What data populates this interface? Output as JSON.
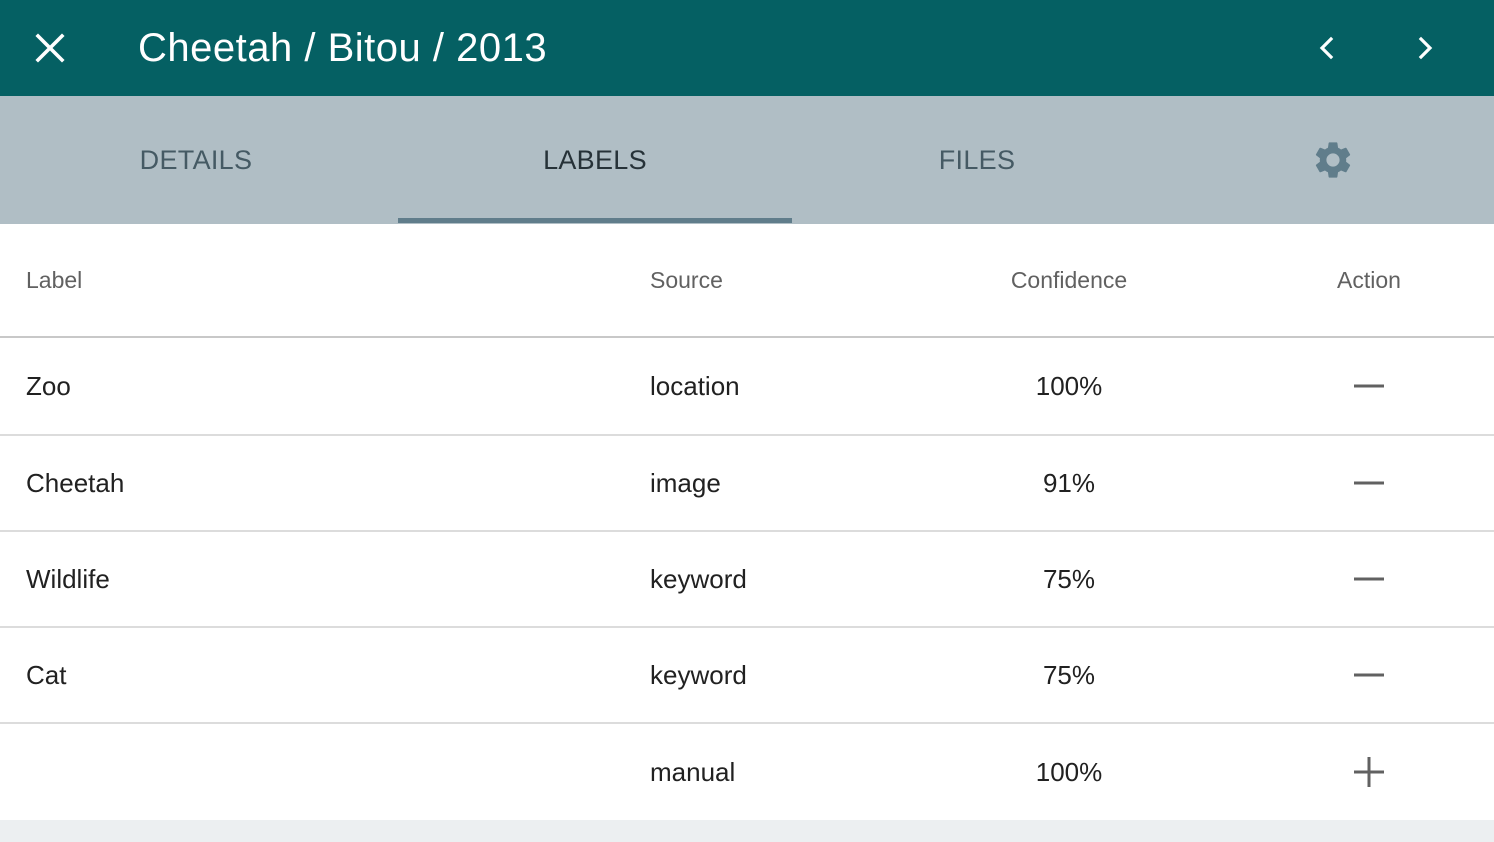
{
  "toolbar": {
    "title": "Cheetah / Bitou / 2013",
    "close_icon": "close-icon",
    "prev_icon": "chevron-left-icon",
    "next_icon": "chevron-right-icon",
    "background_color": "#056063"
  },
  "tabs": [
    {
      "label": "DETAILS",
      "active": false
    },
    {
      "label": "LABELS",
      "active": true
    },
    {
      "label": "FILES",
      "active": false
    },
    {
      "label": "",
      "icon": "gear-icon",
      "active": false
    }
  ],
  "table": {
    "headers": {
      "label": "Label",
      "source": "Source",
      "confidence": "Confidence",
      "action": "Action"
    },
    "rows": [
      {
        "label": "Zoo",
        "source": "location",
        "confidence": "100%",
        "action": "remove"
      },
      {
        "label": "Cheetah",
        "source": "image",
        "confidence": "91%",
        "action": "remove"
      },
      {
        "label": "Wildlife",
        "source": "keyword",
        "confidence": "75%",
        "action": "remove"
      },
      {
        "label": "Cat",
        "source": "keyword",
        "confidence": "75%",
        "action": "remove"
      },
      {
        "label": "",
        "source": "manual",
        "confidence": "100%",
        "action": "add"
      }
    ]
  }
}
